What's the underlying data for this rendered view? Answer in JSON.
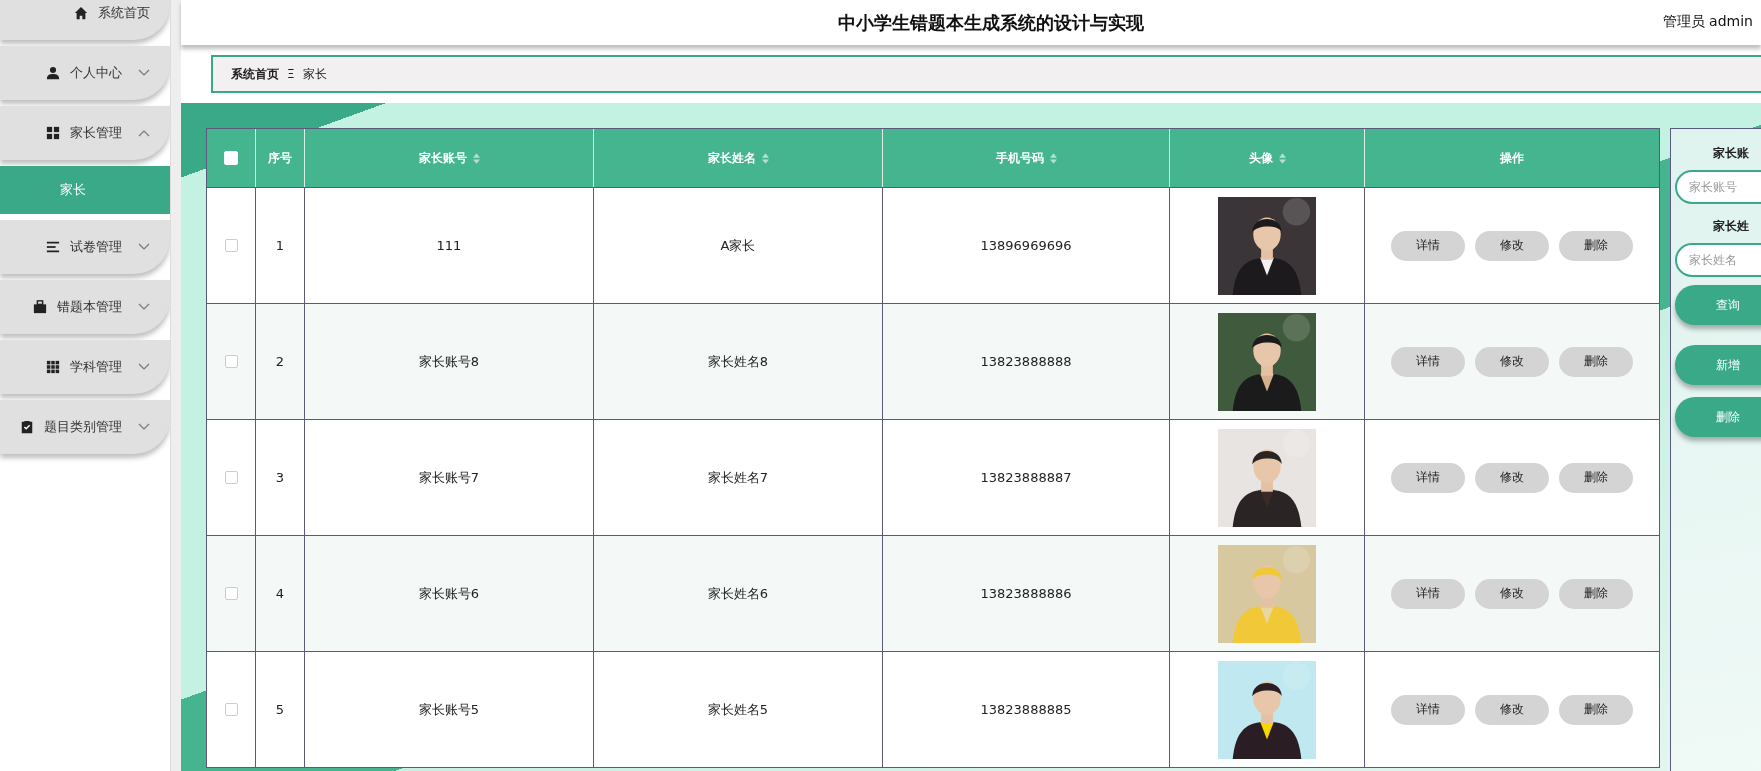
{
  "sidebar": {
    "items": [
      {
        "label": "系统首页"
      },
      {
        "label": "个人中心",
        "expanded": false
      },
      {
        "label": "家长管理",
        "expanded": true,
        "children": [
          {
            "label": "家长",
            "selected": true
          }
        ]
      },
      {
        "label": "试卷管理",
        "expanded": false
      },
      {
        "label": "错题本管理",
        "expanded": false
      },
      {
        "label": "学科管理",
        "expanded": false
      },
      {
        "label": "题目类别管理",
        "expanded": false
      }
    ]
  },
  "header": {
    "title": "中小学生错题本生成系统的设计与实现",
    "user": "管理员 admin"
  },
  "breadcrumb": {
    "home": "系统首页",
    "separator": "Ξ",
    "current": "家长"
  },
  "table": {
    "columns": [
      {
        "label": "序号",
        "sortable": false
      },
      {
        "label": "家长账号",
        "sortable": true
      },
      {
        "label": "家长姓名",
        "sortable": true
      },
      {
        "label": "手机号码",
        "sortable": true
      },
      {
        "label": "头像",
        "sortable": true
      },
      {
        "label": "操作",
        "sortable": false
      }
    ],
    "all_checked": false,
    "rows": [
      {
        "checked": false,
        "index": "1",
        "account": "111",
        "name": "A家长",
        "phone": "13896969696",
        "actions": [
          "详情",
          "修改",
          "删除"
        ]
      },
      {
        "checked": false,
        "index": "2",
        "account": "家长账号8",
        "name": "家长姓名8",
        "phone": "13823888888",
        "actions": [
          "详情",
          "修改",
          "删除"
        ]
      },
      {
        "checked": false,
        "index": "3",
        "account": "家长账号7",
        "name": "家长姓名7",
        "phone": "13823888887",
        "actions": [
          "详情",
          "修改",
          "删除"
        ]
      },
      {
        "checked": false,
        "index": "4",
        "account": "家长账号6",
        "name": "家长姓名6",
        "phone": "13823888886",
        "actions": [
          "详情",
          "修改",
          "删除"
        ]
      },
      {
        "checked": false,
        "index": "5",
        "account": "家长账号5",
        "name": "家长姓名5",
        "phone": "13823888885",
        "actions": [
          "详情",
          "修改",
          "删除"
        ]
      }
    ]
  },
  "search_panel": {
    "fields": [
      {
        "label": "家长账",
        "placeholder": "家长账号"
      },
      {
        "label": "家长姓",
        "placeholder": "家长姓名"
      }
    ],
    "buttons": [
      "查询",
      "新增",
      "删除"
    ]
  }
}
